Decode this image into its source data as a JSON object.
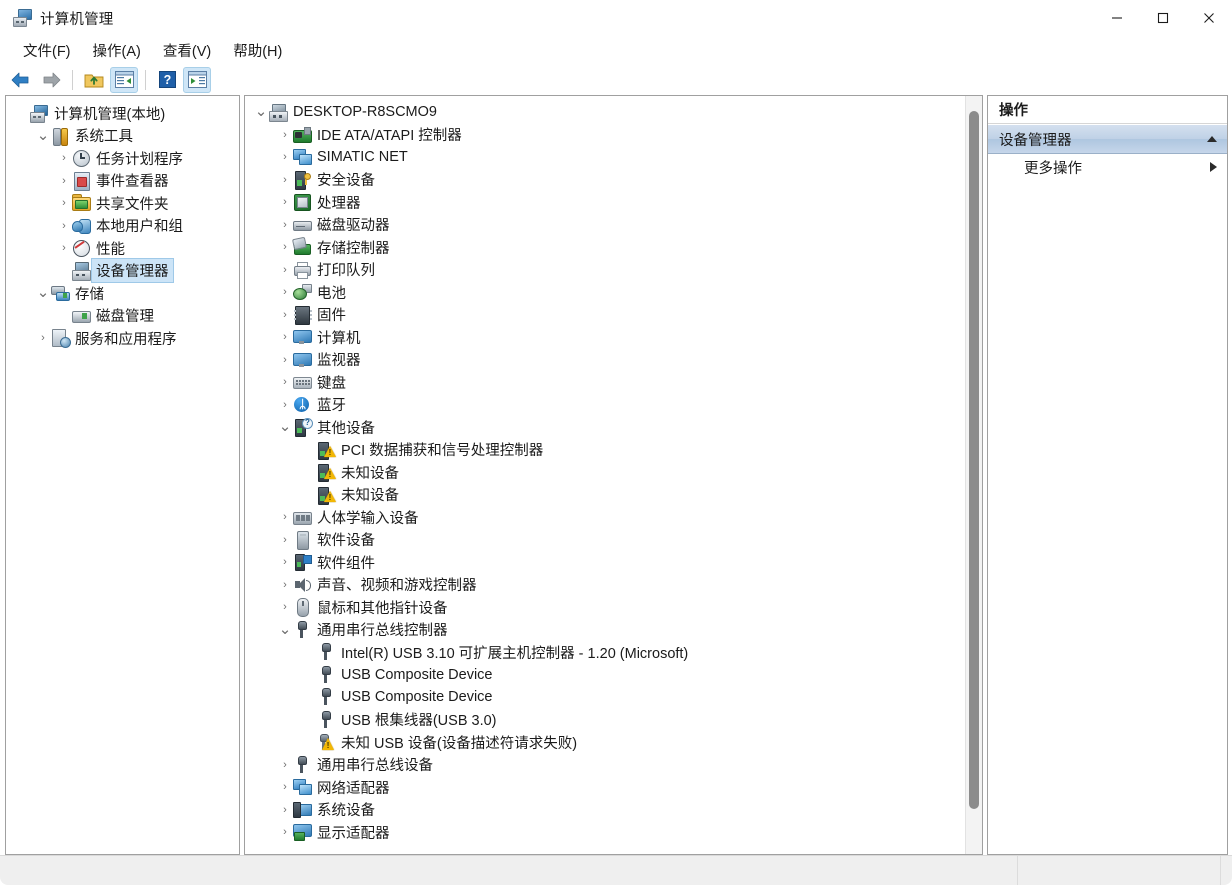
{
  "window": {
    "title": "计算机管理",
    "title_icon": "computer-management-icon",
    "controls": {
      "minimize": "最小化",
      "maximize": "最大化",
      "close": "关闭"
    }
  },
  "menubar": {
    "items": [
      {
        "label": "文件(F)",
        "name": "menu-file"
      },
      {
        "label": "操作(A)",
        "name": "menu-action"
      },
      {
        "label": "查看(V)",
        "name": "menu-view"
      },
      {
        "label": "帮助(H)",
        "name": "menu-help"
      }
    ]
  },
  "toolbar": {
    "buttons": [
      {
        "name": "back-button",
        "icon": "back-arrow-icon",
        "pressed": false
      },
      {
        "name": "forward-button",
        "icon": "forward-arrow-icon",
        "pressed": false
      },
      {
        "name": "up-one-level-button",
        "icon": "up-folder-icon",
        "pressed": false
      },
      {
        "name": "show-console-tree-button",
        "icon": "console-tree-icon",
        "pressed": true
      },
      {
        "name": "help-button",
        "icon": "question-mark-icon",
        "pressed": false
      },
      {
        "name": "show-action-pane-button",
        "icon": "action-pane-icon",
        "pressed": true
      }
    ]
  },
  "console_tree": {
    "items": [
      {
        "label": "计算机管理(本地)",
        "icon": "computer-icon",
        "indent": 0,
        "expander": "none",
        "selected": false
      },
      {
        "label": "系统工具",
        "icon": "system-tools-icon",
        "indent": 1,
        "expander": "expanded",
        "selected": false
      },
      {
        "label": "任务计划程序",
        "icon": "task-scheduler-icon",
        "indent": 2,
        "expander": "collapsed",
        "selected": false
      },
      {
        "label": "事件查看器",
        "icon": "event-viewer-icon",
        "indent": 2,
        "expander": "collapsed",
        "selected": false
      },
      {
        "label": "共享文件夹",
        "icon": "shared-folders-icon",
        "indent": 2,
        "expander": "collapsed",
        "selected": false
      },
      {
        "label": "本地用户和组",
        "icon": "local-users-icon",
        "indent": 2,
        "expander": "collapsed",
        "selected": false
      },
      {
        "label": "性能",
        "icon": "performance-icon",
        "indent": 2,
        "expander": "collapsed",
        "selected": false
      },
      {
        "label": "设备管理器",
        "icon": "device-manager-icon",
        "indent": 2,
        "expander": "none",
        "selected": true
      },
      {
        "label": "存储",
        "icon": "storage-icon",
        "indent": 1,
        "expander": "expanded",
        "selected": false
      },
      {
        "label": "磁盘管理",
        "icon": "disk-management-icon",
        "indent": 2,
        "expander": "none",
        "selected": false
      },
      {
        "label": "服务和应用程序",
        "icon": "services-apps-icon",
        "indent": 1,
        "expander": "collapsed",
        "selected": false
      }
    ]
  },
  "device_tree": {
    "items": [
      {
        "label": "DESKTOP-R8SCMO9",
        "icon": "computer-root-icon",
        "indent": 0,
        "expander": "expanded"
      },
      {
        "label": "IDE ATA/ATAPI 控制器",
        "icon": "ide-controller-icon",
        "indent": 1,
        "expander": "collapsed"
      },
      {
        "label": "SIMATIC NET",
        "icon": "network-icon",
        "indent": 1,
        "expander": "collapsed"
      },
      {
        "label": "安全设备",
        "icon": "security-device-icon",
        "indent": 1,
        "expander": "collapsed"
      },
      {
        "label": "处理器",
        "icon": "processor-icon",
        "indent": 1,
        "expander": "collapsed"
      },
      {
        "label": "磁盘驱动器",
        "icon": "disk-drive-icon",
        "indent": 1,
        "expander": "collapsed"
      },
      {
        "label": "存储控制器",
        "icon": "storage-controller-icon",
        "indent": 1,
        "expander": "collapsed"
      },
      {
        "label": "打印队列",
        "icon": "print-queue-icon",
        "indent": 1,
        "expander": "collapsed"
      },
      {
        "label": "电池",
        "icon": "battery-icon",
        "indent": 1,
        "expander": "collapsed"
      },
      {
        "label": "固件",
        "icon": "firmware-icon",
        "indent": 1,
        "expander": "collapsed"
      },
      {
        "label": "计算机",
        "icon": "monitor-icon",
        "indent": 1,
        "expander": "collapsed"
      },
      {
        "label": "监视器",
        "icon": "monitor-icon",
        "indent": 1,
        "expander": "collapsed"
      },
      {
        "label": "键盘",
        "icon": "keyboard-icon",
        "indent": 1,
        "expander": "collapsed"
      },
      {
        "label": "蓝牙",
        "icon": "bluetooth-icon",
        "indent": 1,
        "expander": "collapsed"
      },
      {
        "label": "其他设备",
        "icon": "other-devices-icon",
        "indent": 1,
        "expander": "expanded"
      },
      {
        "label": "PCI 数据捕获和信号处理控制器",
        "icon": "unknown-device-warning-icon",
        "indent": 2,
        "expander": "none"
      },
      {
        "label": "未知设备",
        "icon": "unknown-device-warning-icon",
        "indent": 2,
        "expander": "none"
      },
      {
        "label": "未知设备",
        "icon": "unknown-device-warning-icon",
        "indent": 2,
        "expander": "none"
      },
      {
        "label": "人体学输入设备",
        "icon": "hid-icon",
        "indent": 1,
        "expander": "collapsed"
      },
      {
        "label": "软件设备",
        "icon": "software-device-icon",
        "indent": 1,
        "expander": "collapsed"
      },
      {
        "label": "软件组件",
        "icon": "software-component-icon",
        "indent": 1,
        "expander": "collapsed"
      },
      {
        "label": "声音、视频和游戏控制器",
        "icon": "sound-icon",
        "indent": 1,
        "expander": "collapsed"
      },
      {
        "label": "鼠标和其他指针设备",
        "icon": "mouse-icon",
        "indent": 1,
        "expander": "collapsed"
      },
      {
        "label": "通用串行总线控制器",
        "icon": "usb-icon",
        "indent": 1,
        "expander": "expanded"
      },
      {
        "label": "Intel(R) USB 3.10 可扩展主机控制器 - 1.20 (Microsoft)",
        "icon": "usb-icon",
        "indent": 2,
        "expander": "none"
      },
      {
        "label": "USB Composite Device",
        "icon": "usb-icon",
        "indent": 2,
        "expander": "none"
      },
      {
        "label": "USB Composite Device",
        "icon": "usb-icon",
        "indent": 2,
        "expander": "none"
      },
      {
        "label": "USB 根集线器(USB 3.0)",
        "icon": "usb-icon",
        "indent": 2,
        "expander": "none"
      },
      {
        "label": "未知 USB 设备(设备描述符请求失败)",
        "icon": "usb-warning-icon",
        "indent": 2,
        "expander": "none"
      },
      {
        "label": "通用串行总线设备",
        "icon": "usb-icon",
        "indent": 1,
        "expander": "collapsed"
      },
      {
        "label": "网络适配器",
        "icon": "network-icon",
        "indent": 1,
        "expander": "collapsed"
      },
      {
        "label": "系统设备",
        "icon": "system-device-icon",
        "indent": 1,
        "expander": "collapsed"
      },
      {
        "label": "显示适配器",
        "icon": "display-adapter-icon",
        "indent": 1,
        "expander": "collapsed"
      }
    ],
    "scrollbar": {
      "thumb_top_pct": 2,
      "thumb_height_pct": 92
    }
  },
  "actions_pane": {
    "header": "操作",
    "group_title": "设备管理器",
    "group_collapse_icon": "chevron-up-icon",
    "items": [
      {
        "label": "更多操作",
        "submenu_icon": "chevron-right-icon"
      }
    ]
  },
  "statusbar": {
    "text": ""
  },
  "colors": {
    "selection_blue": "#cce4f7",
    "group_bar_blue": "#bfd1e6",
    "warning_yellow": "#f2b705",
    "accent_blue": "#2f79b5",
    "scrollbar_thumb": "#8c8c8c",
    "window_border": "#a0a0a0"
  }
}
